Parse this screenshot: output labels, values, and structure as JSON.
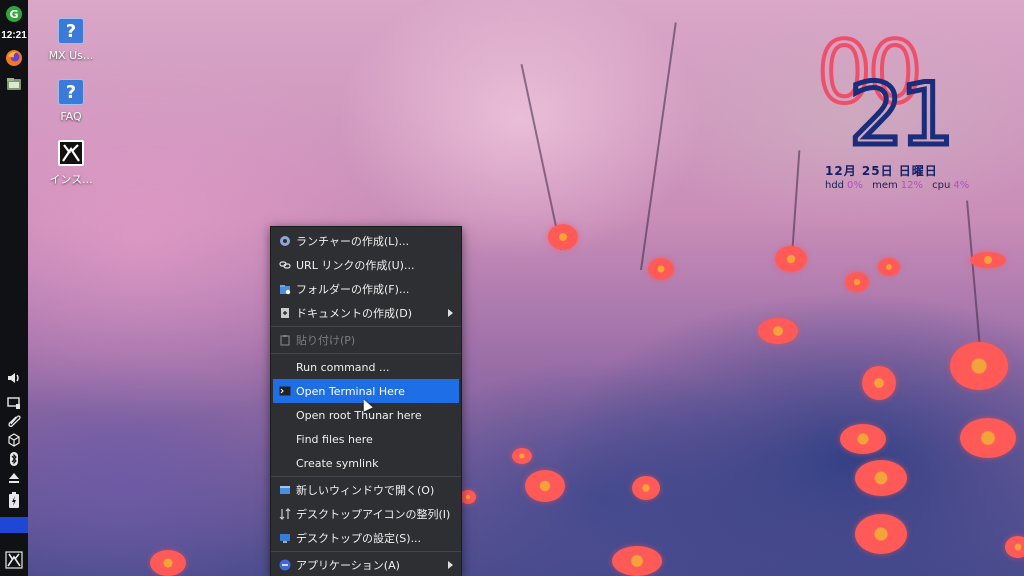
{
  "taskbar": {
    "clock": "12:21",
    "icons": [
      "menu-g-icon",
      "firefox-icon",
      "file-manager-icon",
      "volume-icon",
      "display-icon",
      "clip-icon",
      "package-icon",
      "bluetooth-icon",
      "eject-icon",
      "battery-icon",
      "mx-logo-icon"
    ]
  },
  "desktop_icons": [
    {
      "label": "MX Us...",
      "icon": "help-icon"
    },
    {
      "label": "FAQ",
      "icon": "help-icon"
    },
    {
      "label": "インス...",
      "icon": "mx-installer-icon"
    }
  ],
  "conky": {
    "hour": "00",
    "minute": "21",
    "date": "12月 25日 日曜日",
    "hdd_label": "hdd",
    "hdd_value": "0%",
    "mem_label": "mem",
    "mem_value": "12%",
    "cpu_label": "cpu",
    "cpu_value": "4%",
    "colors": {
      "hour": "#ef4f6a",
      "minute": "#1a2d7a",
      "value": "#b24ec0"
    }
  },
  "context_menu": {
    "items": [
      {
        "label": "ランチャーの作成(L)...",
        "icon": "launcher-icon"
      },
      {
        "label": "URL リンクの作成(U)...",
        "icon": "link-icon"
      },
      {
        "label": "フォルダーの作成(F)...",
        "icon": "folder-icon"
      },
      {
        "label": "ドキュメントの作成(D)",
        "icon": "document-icon",
        "submenu": true
      },
      {
        "label": "貼り付け(P)",
        "icon": "paste-icon",
        "disabled": true
      },
      {
        "label": "Run command ..."
      },
      {
        "label": "Open Terminal Here",
        "icon": "terminal-icon",
        "highlighted": true
      },
      {
        "label": "Open root Thunar here"
      },
      {
        "label": "Find files here"
      },
      {
        "label": "Create symlink"
      },
      {
        "label": "新しいウィンドウで開く(O)",
        "icon": "window-icon"
      },
      {
        "label": "デスクトップアイコンの整列(I)",
        "icon": "arrange-icon"
      },
      {
        "label": "デスクトップの設定(S)...",
        "icon": "desktop-settings-icon"
      },
      {
        "label": "アプリケーション(A)",
        "icon": "applications-icon",
        "submenu": true
      }
    ],
    "highlight_color": "#1e6fe6"
  }
}
